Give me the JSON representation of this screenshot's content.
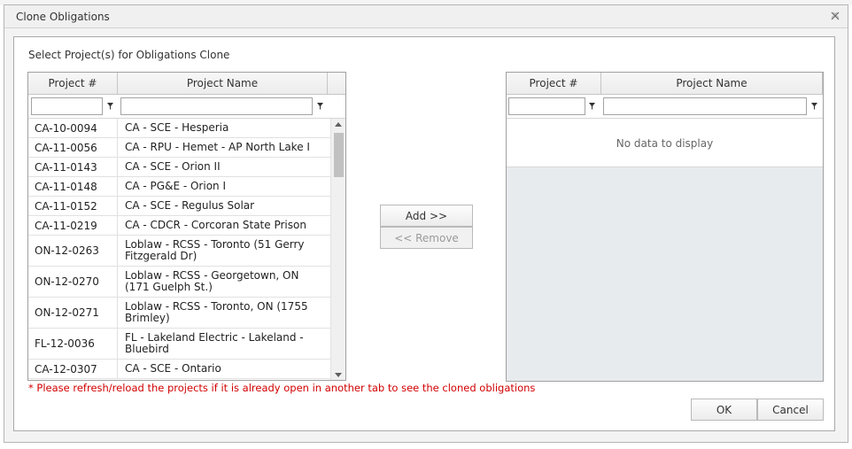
{
  "dialog": {
    "title": "Clone Obligations"
  },
  "section_label": "Select Project(s) for Obligations Clone",
  "left_grid": {
    "columns": [
      "Project #",
      "Project Name"
    ],
    "rows": [
      {
        "num": "CA-10-0094",
        "name": "CA - SCE - Hesperia"
      },
      {
        "num": "CA-11-0056",
        "name": "CA - RPU - Hemet - AP North Lake I"
      },
      {
        "num": "CA-11-0143",
        "name": "CA - SCE - Orion II"
      },
      {
        "num": "CA-11-0148",
        "name": "CA - PG&E - Orion I"
      },
      {
        "num": "CA-11-0152",
        "name": "CA - SCE - Regulus Solar"
      },
      {
        "num": "CA-11-0219",
        "name": "CA - CDCR - Corcoran State Prison"
      },
      {
        "num": "ON-12-0263",
        "name": "Loblaw - RCSS - Toronto (51 Gerry Fitzgerald Dr)"
      },
      {
        "num": "ON-12-0270",
        "name": "Loblaw - RCSS - Georgetown, ON (171 Guelph St.)"
      },
      {
        "num": "ON-12-0271",
        "name": "Loblaw - RCSS - Toronto, ON (1755 Brimley)"
      },
      {
        "num": "FL-12-0036",
        "name": "FL - Lakeland Electric - Lakeland - Bluebird"
      },
      {
        "num": "CA-12-0307",
        "name": "CA - SCE - Ontario"
      }
    ]
  },
  "right_grid": {
    "columns": [
      "Project #",
      "Project Name"
    ],
    "empty_text": "No data to display"
  },
  "buttons": {
    "add": "Add >>",
    "remove": "<< Remove",
    "ok": "OK",
    "cancel": "Cancel"
  },
  "warning": "* Please refresh/reload the projects if it is already open in another tab to see the cloned obligations",
  "colors": {
    "warning": "#d20000",
    "border": "#a0a0a0"
  }
}
